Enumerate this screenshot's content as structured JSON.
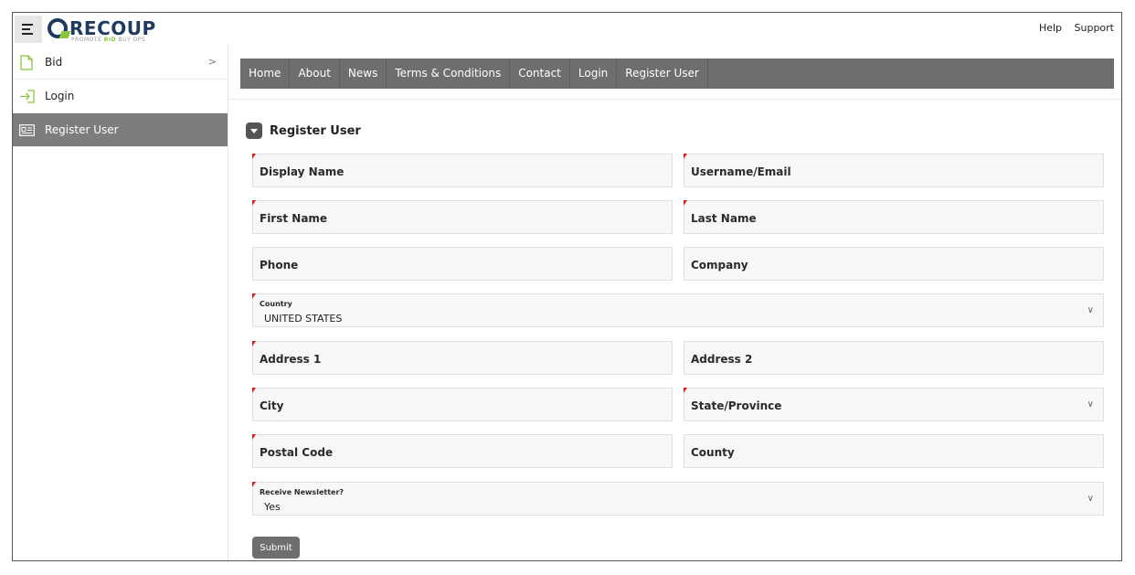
{
  "header": {
    "logo_word": "RECOUP",
    "logo_tagline_pre": "PROMOTE ",
    "logo_tagline_bid": "BID",
    "logo_tagline_post": " BUY OPS",
    "links": [
      "Help",
      "Support"
    ]
  },
  "sidebar": {
    "items": [
      {
        "label": "Bid",
        "icon": "document-icon"
      },
      {
        "label": "Login",
        "icon": "login-arrow-icon"
      },
      {
        "label": "Register User",
        "icon": "id-card-icon"
      }
    ]
  },
  "nav": {
    "items": [
      "Home",
      "About",
      "News",
      "Terms & Conditions",
      "Contact",
      "Login",
      "Register User"
    ]
  },
  "form": {
    "title": "Register User",
    "display_name": "Display Name",
    "username": "Username/Email",
    "first_name": "First Name",
    "last_name": "Last Name",
    "phone": "Phone",
    "company": "Company",
    "country_label": "Country",
    "country_value": "UNITED STATES",
    "address1": "Address 1",
    "address2": "Address 2",
    "city": "City",
    "state": "State/Province",
    "postal": "Postal Code",
    "county": "County",
    "newsletter_label": "Receive Newsletter?",
    "newsletter_value": "Yes",
    "submit": "Submit"
  },
  "colors": {
    "accent_gray": "#6e6e6e",
    "required_marker": "#d81e1e",
    "logo_navy": "#1e3a5f",
    "logo_green": "#8bc53f"
  }
}
